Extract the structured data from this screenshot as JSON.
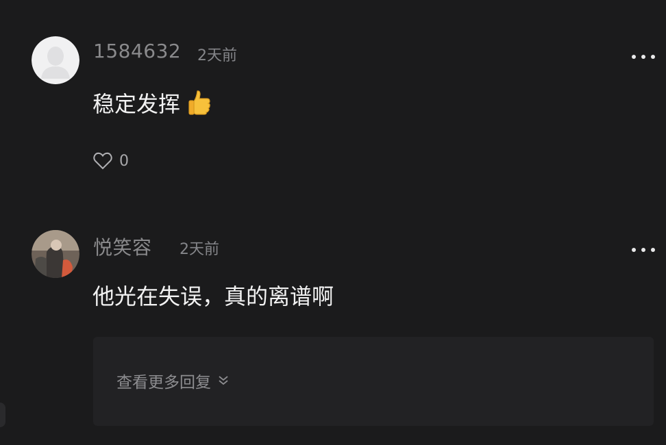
{
  "comments": [
    {
      "username": "1584632",
      "time": "2天前",
      "text": "稳定发挥",
      "emoji_icon": "thumbs-up-icon",
      "likes": "0"
    },
    {
      "username": "悦笑容",
      "time": "2天前",
      "text": "他光在失误，真的离谱啊"
    }
  ],
  "replies": {
    "label": "查看更多回复"
  },
  "colors": {
    "background": "#1b1b1c",
    "reply_box": "#222224",
    "username": "#8a8a8c",
    "content": "#f2f2f2"
  }
}
